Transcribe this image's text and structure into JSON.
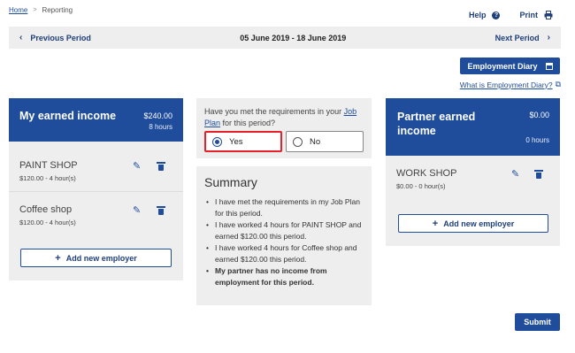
{
  "breadcrumb": {
    "home": "Home",
    "separator": ">",
    "current": "Reporting"
  },
  "top_actions": {
    "help": "Help",
    "print": "Print"
  },
  "period": {
    "previous": "Previous Period",
    "range": "05 June 2019 - 18 June 2019",
    "next": "Next Period"
  },
  "diary": {
    "button": "Employment Diary",
    "link": "What is Employment Diary?"
  },
  "my_income": {
    "title": "My earned income",
    "amount": "$240.00",
    "hours": "8 hours",
    "employers": [
      {
        "name": "PAINT SHOP",
        "detail": "$120.00 - 4 hour(s)"
      },
      {
        "name": "Coffee shop",
        "detail": "$120.00 - 4 hour(s)"
      }
    ],
    "add_label": "Add new employer"
  },
  "question": {
    "text_before": "Have you met the requirements in your ",
    "link": "Job Plan",
    "text_after": " for this period?",
    "yes": "Yes",
    "no": "No",
    "selected": "yes"
  },
  "summary": {
    "title": "Summary",
    "items": [
      "I have met the requirements in my Job Plan for this period.",
      "I have worked 4 hours for PAINT SHOP and earned $120.00 this period.",
      "I have worked 4 hours for Coffee shop and earned $120.00 this period.",
      "My partner has no income from employment for this period."
    ]
  },
  "partner_income": {
    "title": "Partner earned income",
    "amount": "$0.00",
    "hours": "0 hours",
    "employers": [
      {
        "name": "WORK SHOP",
        "detail": "$0.00 - 0 hour(s)"
      }
    ],
    "add_label": "Add new employer"
  },
  "submit": "Submit",
  "colors": {
    "primary": "#1f4d9b",
    "panel": "#eeeeee",
    "highlight": "#e8202a"
  }
}
